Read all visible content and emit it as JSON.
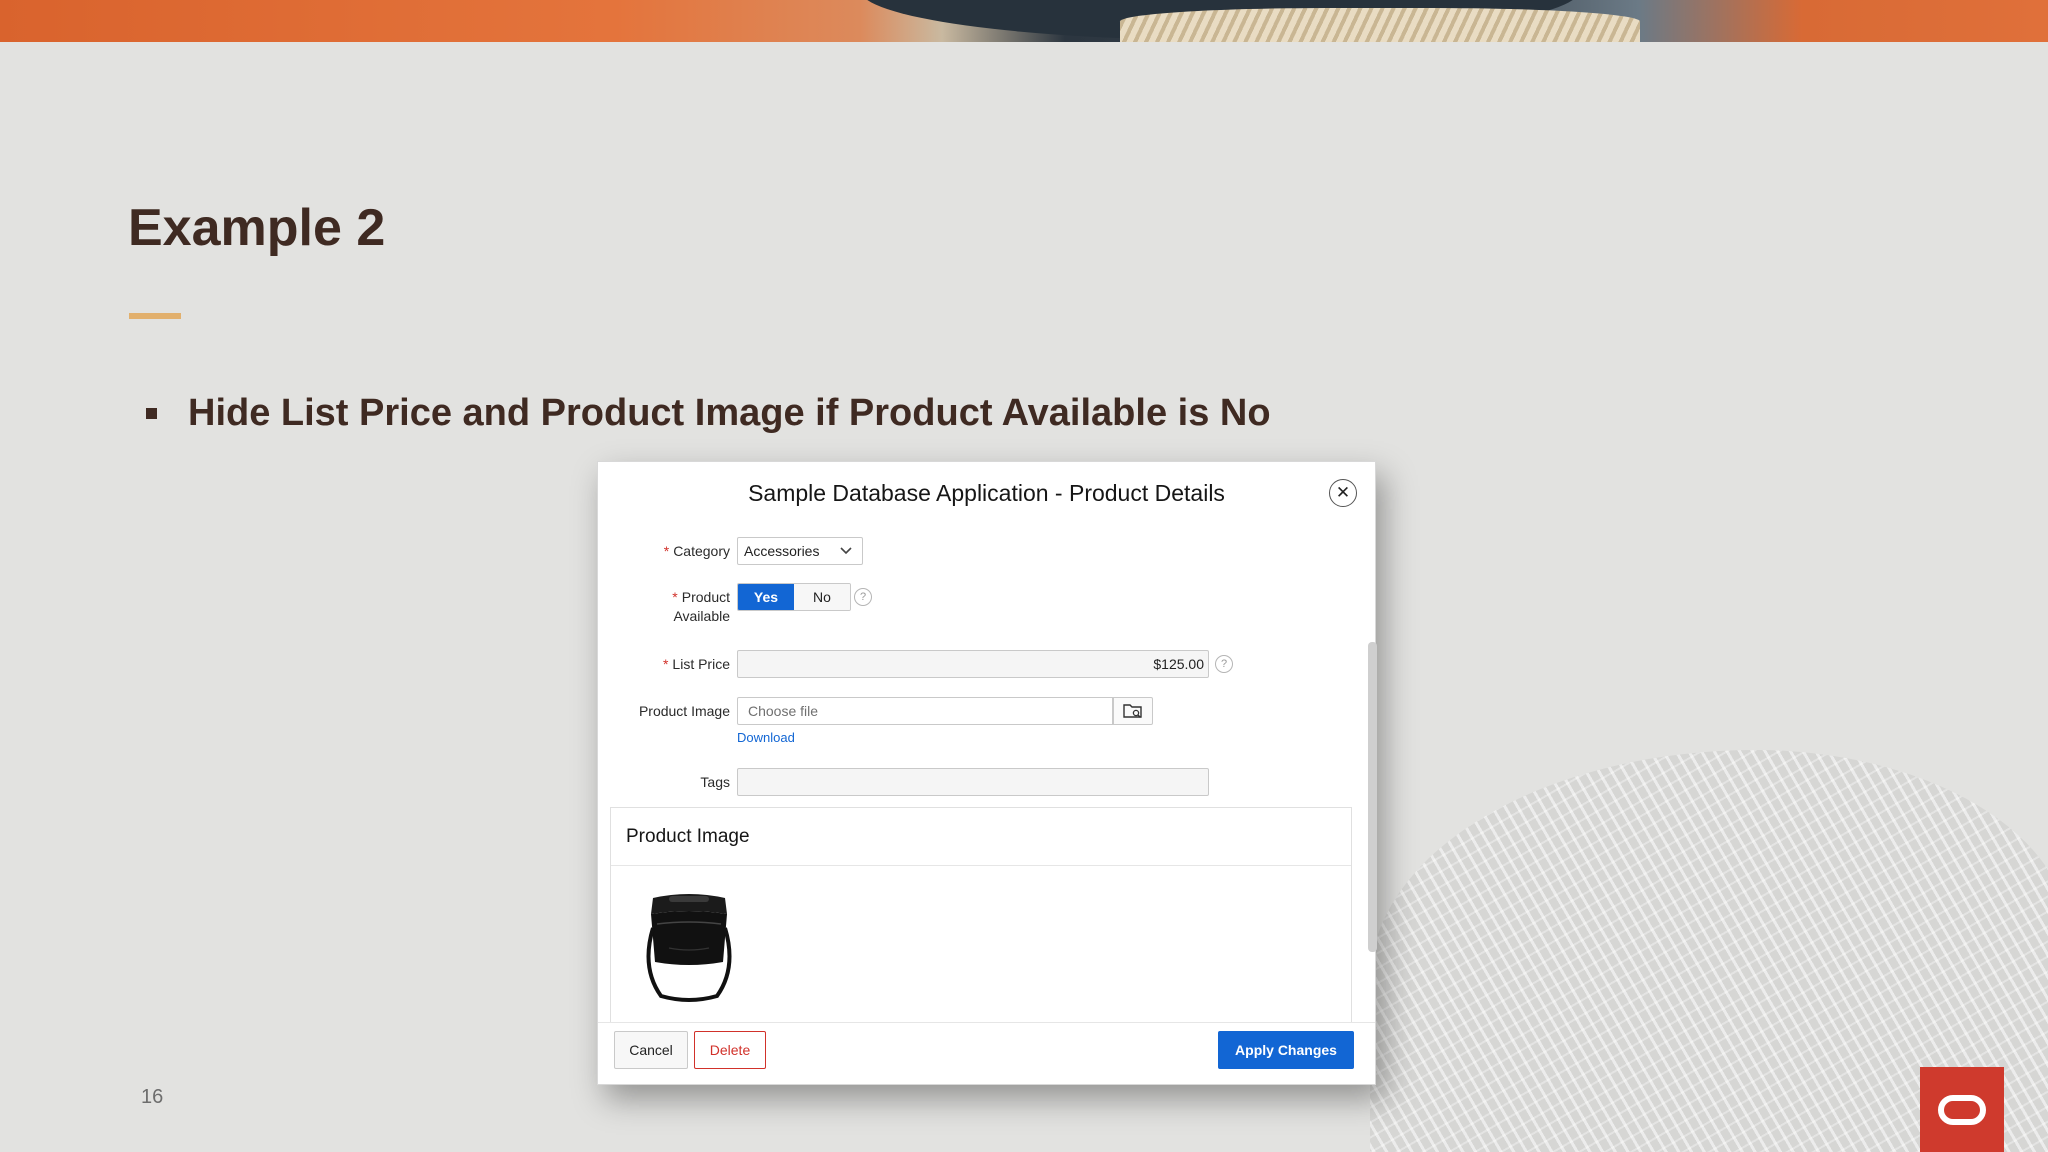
{
  "slide": {
    "title": "Example 2",
    "bullet": "Hide List Price and Product Image if Product Available is No",
    "page_number": "16",
    "accent_color": "#e2b06d",
    "brand_color": "#cf3a2d"
  },
  "dialog": {
    "title": "Sample Database Application - Product Details",
    "close_icon": "close-icon",
    "fields": {
      "category": {
        "label": "Category",
        "value": "Accessories",
        "required": true
      },
      "product_available": {
        "label_line1": "Product",
        "label_line2": "Available",
        "options": [
          "Yes",
          "No"
        ],
        "selected": "Yes",
        "required": true
      },
      "list_price": {
        "label": "List Price",
        "value": "$125.00",
        "required": true
      },
      "product_image": {
        "label": "Product Image",
        "placeholder": "Choose file",
        "link": "Download"
      },
      "tags": {
        "label": "Tags",
        "value": ""
      }
    },
    "image_region": {
      "title": "Product Image"
    },
    "buttons": {
      "cancel": "Cancel",
      "delete": "Delete",
      "apply": "Apply Changes"
    },
    "primary_color": "#1266d4",
    "required_color": "#d1312a"
  }
}
